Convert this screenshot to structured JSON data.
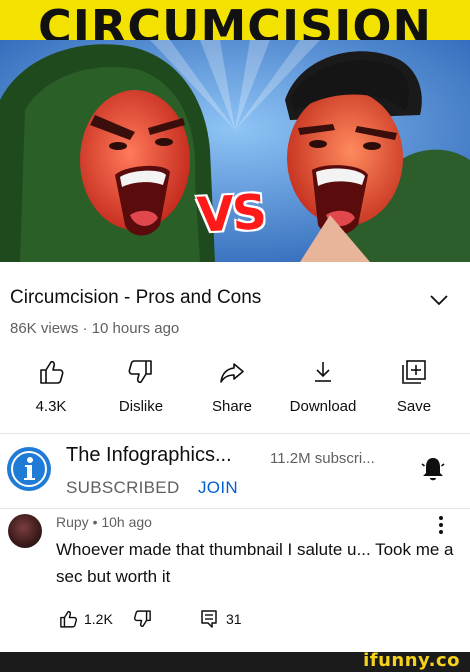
{
  "thumbnail": {
    "banner_text": "CIRCUMCISION",
    "vs_text": "VS",
    "colors": {
      "banner": "#f3e100",
      "sky": "#3b79c8",
      "vs": "#ff1a1a"
    }
  },
  "video": {
    "title": "Circumcision - Pros and Cons",
    "meta": "86K views · 10 hours ago"
  },
  "actions": [
    {
      "icon": "thumbs-up-icon",
      "label": "4.3K"
    },
    {
      "icon": "thumbs-down-icon",
      "label": "Dislike"
    },
    {
      "icon": "share-icon",
      "label": "Share"
    },
    {
      "icon": "download-icon",
      "label": "Download"
    },
    {
      "icon": "save-icon",
      "label": "Save"
    }
  ],
  "channel": {
    "name": "The Infographics...",
    "subscribers": "11.2M subscri...",
    "subscribed_label": "SUBSCRIBED",
    "join_label": "JOIN",
    "avatar_letter": "i",
    "colors": {
      "join": "#065fd4",
      "avatar": "#1f7bd6"
    }
  },
  "comment": {
    "author_time": "Rupy • 10h ago",
    "text": "Whoever made that thumbnail I salute u... Took me a sec but worth it",
    "likes": "1.2K",
    "replies": "31"
  },
  "footer": {
    "brand": "ifunny.co",
    "color": "#f6d31a"
  }
}
